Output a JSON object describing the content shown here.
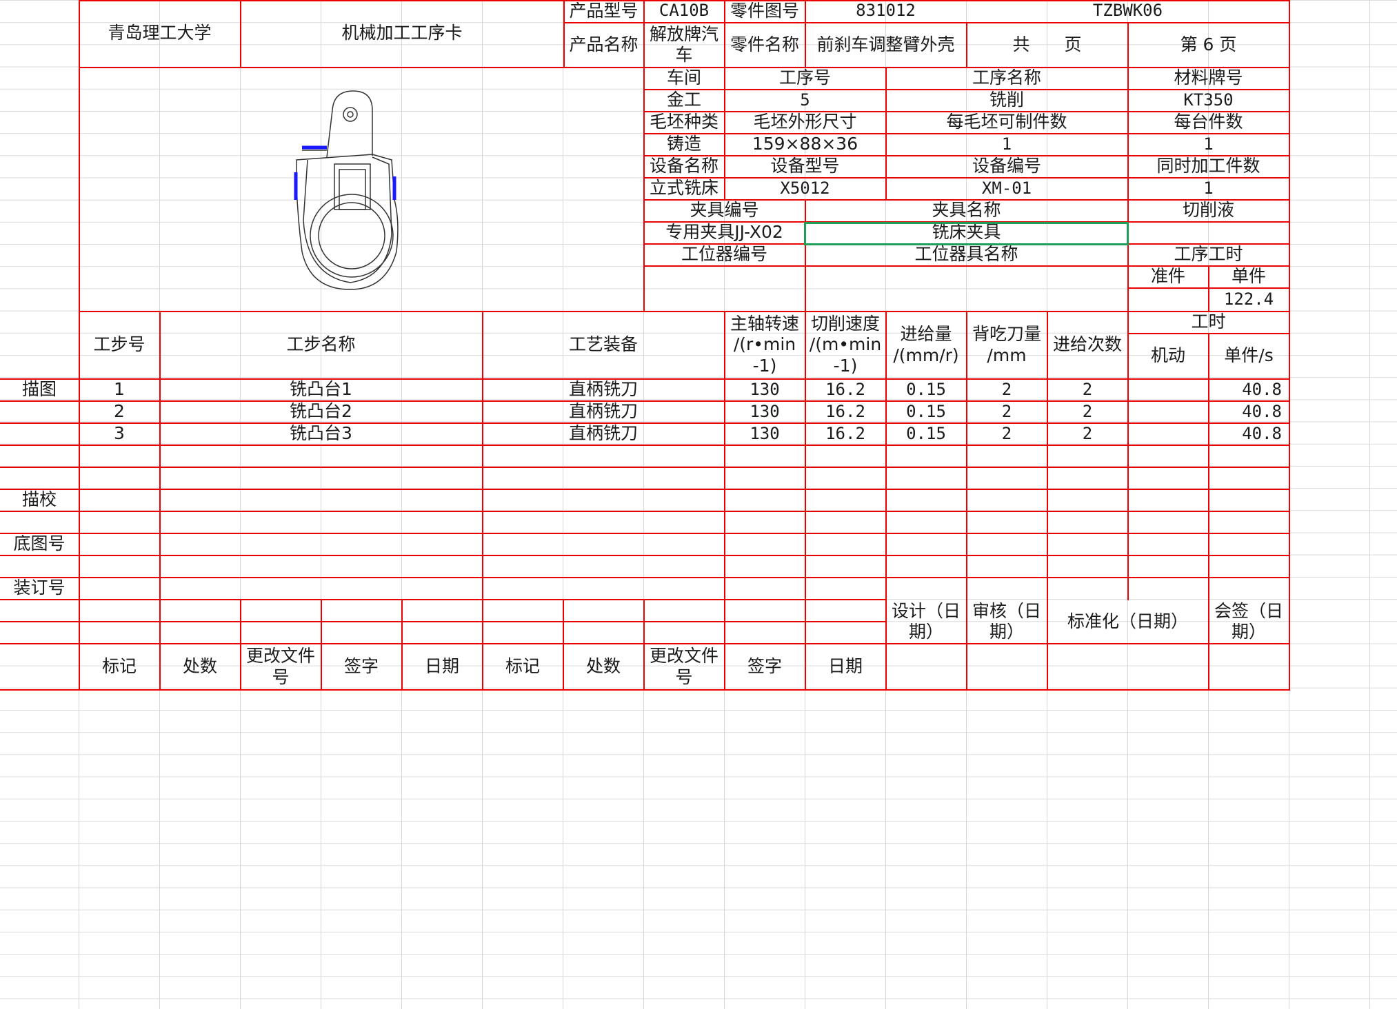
{
  "header": {
    "school": "青岛理工大学",
    "card_title": "机械加工工序卡",
    "product_model_label": "产品型号",
    "product_model": "CA10B",
    "part_drawing_no_label": "零件图号",
    "part_drawing_no": "831012",
    "doc_code": "TZBWK06",
    "product_name_label": "产品名称",
    "product_name": "解放牌汽\n车",
    "part_name_label": "零件名称",
    "part_name": "前刹车调整臂外壳",
    "total_pages": "共　　页",
    "page_no": "第 6 页"
  },
  "info": {
    "workshop_label": "车间",
    "op_no_label": "工序号",
    "op_name_label": "工序名称",
    "material_label": "材料牌号",
    "workshop": "金工",
    "op_no": "5",
    "op_name": "铣削",
    "material": "KT350",
    "blank_type_label": "毛坯种类",
    "blank_size_label": "毛坯外形尺寸",
    "per_blank_label": "每毛坯可制件数",
    "per_unit_label": "每台件数",
    "blank_type": "铸造",
    "blank_size": "159×88×36",
    "per_blank": "1",
    "per_unit": "1",
    "equip_name_label": "设备名称",
    "equip_model_label": "设备型号",
    "equip_no_label": "设备编号",
    "simul_label": "同时加工件数",
    "equip_name": "立式铣床",
    "equip_model": "X5012",
    "equip_no": "XM-01",
    "simul": "1",
    "fixture_no_label": "夹具编号",
    "fixture_name_label": "夹具名称",
    "coolant_label": "切削液",
    "fixture_no": "专用夹具JJ-X02",
    "fixture_name": "铣床夹具",
    "coolant": "",
    "station_no_label": "工位器编号",
    "station_name_label": "工位器具名称",
    "op_time_label": "工序工时",
    "prep_label": "准件",
    "unit_label": "单件",
    "unit_time": "122.4"
  },
  "steps_header": {
    "step_no": "工步号",
    "step_name": "工步名称",
    "equipment": "工艺装备",
    "spindle": "主轴转速\n/(r•min\n-1)",
    "cut_speed": "切削速度\n/(m•min\n-1)",
    "feed": "进给量\n/(mm/r)",
    "depth": "背吃刀量\n/mm",
    "passes": "进给次数",
    "time": "工时",
    "machine_time": "机动",
    "unit_time": "单件/s"
  },
  "steps": [
    {
      "no": "1",
      "name": "铣凸台1",
      "equip": "直柄铣刀",
      "spindle": "130",
      "speed": "16.2",
      "feed": "0.15",
      "depth": "2",
      "passes": "2",
      "machine": "",
      "unit": "40.8"
    },
    {
      "no": "2",
      "name": "铣凸台2",
      "equip": "直柄铣刀",
      "spindle": "130",
      "speed": "16.2",
      "feed": "0.15",
      "depth": "2",
      "passes": "2",
      "machine": "",
      "unit": "40.8"
    },
    {
      "no": "3",
      "name": "铣凸台3",
      "equip": "直柄铣刀",
      "spindle": "130",
      "speed": "16.2",
      "feed": "0.15",
      "depth": "2",
      "passes": "2",
      "machine": "",
      "unit": "40.8"
    }
  ],
  "side_labels": [
    "描图",
    "描校",
    "底图号",
    "装订号"
  ],
  "signoff": {
    "design": "设计（日\n期）",
    "review": "审核（日\n期）",
    "standard": "标准化（日期）",
    "countersign": "会签（日\n期）"
  },
  "footer_labels": [
    "标记",
    "处数",
    "更改文件\n号",
    "签字",
    "日期",
    "标记",
    "处数",
    "更改文件\n号",
    "签字",
    "日期"
  ],
  "colors": {
    "border": "#ee0000",
    "gridline": "#d9d9d9",
    "selection": "#1f9e5a",
    "highlight_edge": "#1a1aff"
  }
}
